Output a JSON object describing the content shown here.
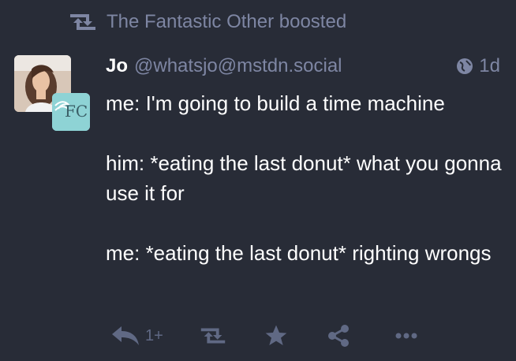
{
  "boost_line": {
    "text": "The Fantastic Other boosted",
    "icon": "retweet-icon"
  },
  "status": {
    "display_name": "Jo",
    "acct": "@whatsjo@mstdn.social",
    "visibility_icon": "globe-icon",
    "relative_time": "1d",
    "paragraphs": [
      "me: I'm going to build a time machine",
      "him: *eating the last donut* what you gonna use it for",
      "me: *eating the last donut* righting wrongs"
    ],
    "boost_avatar_text": "FC"
  },
  "actions": {
    "reply_icon": "reply-icon",
    "reply_count": "1+",
    "boost_icon": "retweet-icon",
    "favourite_icon": "star-icon",
    "share_icon": "share-icon",
    "more_icon": "ellipsis-icon"
  },
  "colors": {
    "background": "#282c37",
    "muted": "#7e86a3",
    "action_muted": "#606984",
    "text": "#ffffff",
    "boost_avatar_bg": "#8ed3d5"
  }
}
